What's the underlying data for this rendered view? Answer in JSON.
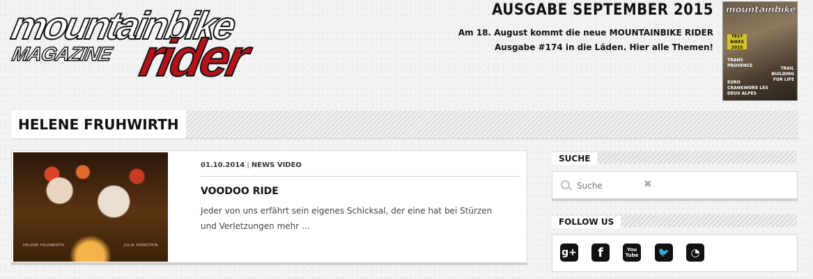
{
  "header": {
    "logo": {
      "line1": "mountainbike",
      "line2": "MAGAZINE",
      "line3": "rider"
    },
    "issue_title": "AUSGABE SEPTEMBER 2015",
    "issue_text_line1": "Am 18. August kommt die neue MOUNTAINBIKE RIDER",
    "issue_text_line2": "Ausgabe #174 in die Läden. Hier alle Themen!",
    "cover": {
      "title": "mountainbike",
      "sticker": "TEST BIKES 2015",
      "headline_left": "TRANS PROVENCE",
      "headline_right": "TRAIL BUILDING FOR LIFE",
      "headline_bottom": "EURO CRANKWORX LES DEUX ALPES"
    }
  },
  "page_title": "HELENE FRUHWIRTH",
  "article": {
    "date": "01.10.2014",
    "separator": "|",
    "category": "NEWS VIDEO",
    "title": "VOODOO RIDE",
    "excerpt": "Jeder von uns erfährt sein eigenes Schicksal, der eine hat bei Stürzen und Verletzungen mehr ...",
    "thumb_caption_left": "HELENE FRUHWIRTH",
    "thumb_caption_right": "JULIA HIRNSTEIN"
  },
  "sidebar": {
    "search_heading": "SUCHE",
    "search_placeholder": "Suche",
    "clear_glyph": "✖",
    "follow_heading": "FOLLOW US",
    "social": [
      {
        "icon": "google-plus-icon",
        "glyph": "g+"
      },
      {
        "icon": "facebook-icon",
        "glyph": "f"
      },
      {
        "icon": "youtube-icon",
        "glyph": "You Tube"
      },
      {
        "icon": "twitter-icon",
        "glyph": "🐦"
      },
      {
        "icon": "rss-icon",
        "glyph": "◔"
      }
    ]
  }
}
